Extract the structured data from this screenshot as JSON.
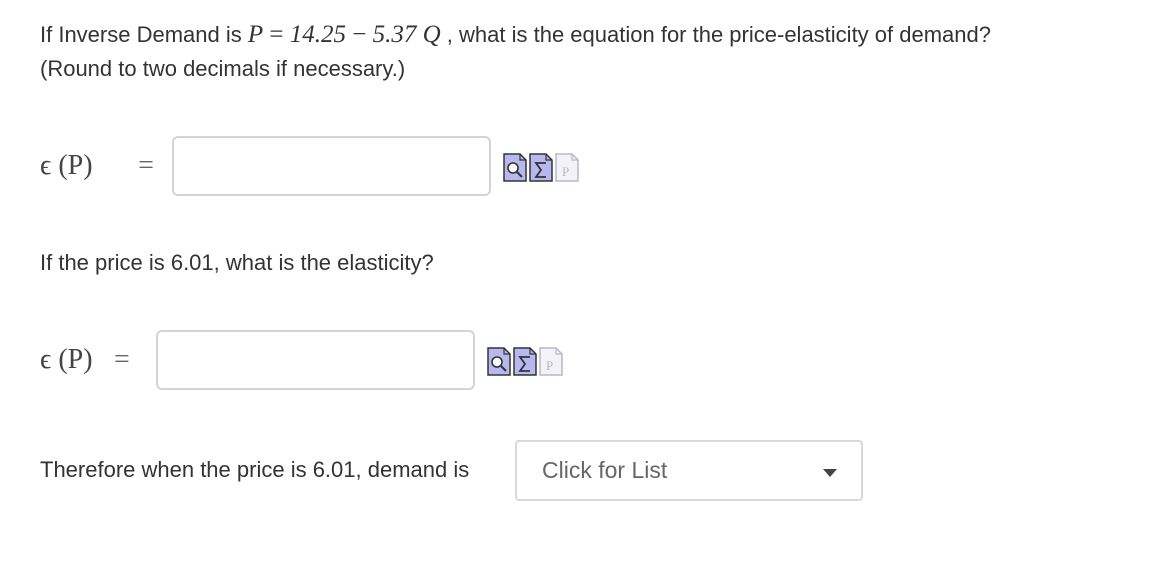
{
  "question1": {
    "prefix": "If Inverse Demand is ",
    "var_p": "P",
    "equals": " = ",
    "intercept": "14.25",
    "minus": " − ",
    "slope": "5.37",
    "var_q": " Q",
    "suffix": " , what is the equation for the price-elasticity of demand?",
    "line2": "(Round to two decimals if necessary.)"
  },
  "row1": {
    "label": "ϵ (P)",
    "equals": "=",
    "value": ""
  },
  "question2": {
    "text": "If the price is 6.01, what is the elasticity?"
  },
  "row2": {
    "label": "ϵ (P)",
    "equals": "=",
    "value": ""
  },
  "question3": {
    "text": "Therefore when the price is 6.01, demand is"
  },
  "dropdown": {
    "placeholder": "Click for List"
  },
  "icons": [
    "preview-icon",
    "equation-editor-icon",
    "formula-icon"
  ]
}
